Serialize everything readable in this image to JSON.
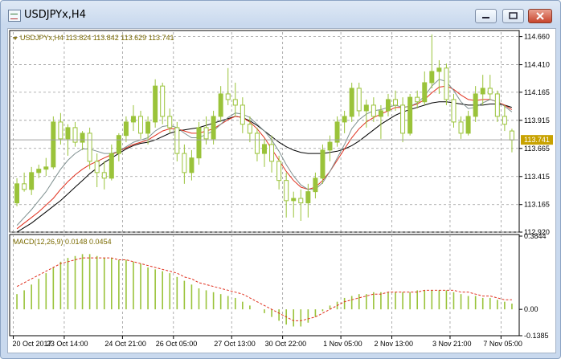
{
  "window": {
    "title": "USDJPYx,H4"
  },
  "chart_data": [
    {
      "type": "candlestick",
      "symbol": "USDJPYx",
      "timeframe": "H4",
      "info_line": "USDJPYx,H4  113.824 113.842 113.629 113.741",
      "ohlc_header": {
        "open": 113.824,
        "high": 113.842,
        "low": 113.629,
        "close": 113.741
      },
      "current_price": 113.741,
      "ylim": [
        112.92,
        114.7
      ],
      "y_ticks": [
        "114.660",
        "114.410",
        "114.165",
        "113.915",
        "113.665",
        "113.415",
        "113.165",
        "112.920"
      ],
      "x_ticks": [
        "20 Oct 2017",
        "23 Oct 14:00",
        "24 Oct 21:00",
        "26 Oct 05:00",
        "27 Oct 13:00",
        "30 Oct 22:00",
        "1 Nov 05:00",
        "2 Nov 13:00",
        "3 Nov 21:00",
        "7 Nov 05:00"
      ],
      "colors": {
        "bull": "#9ac33a",
        "bear": "#9ac33a",
        "ma_fast": "#7f9090",
        "ma_mid": "#e0301e",
        "ma_slow": "#000000",
        "price_line": "#a0a0a0",
        "price_tag": "#c8a200"
      },
      "candles": [
        [
          113.18,
          113.4,
          113.15,
          113.35
        ],
        [
          113.35,
          113.45,
          113.28,
          113.3
        ],
        [
          113.3,
          113.5,
          113.25,
          113.45
        ],
        [
          113.45,
          113.52,
          113.4,
          113.48
        ],
        [
          113.48,
          113.58,
          113.42,
          113.5
        ],
        [
          113.5,
          113.95,
          113.48,
          113.9
        ],
        [
          113.9,
          113.98,
          113.7,
          113.75
        ],
        [
          113.75,
          113.88,
          113.6,
          113.85
        ],
        [
          113.85,
          113.9,
          113.68,
          113.72
        ],
        [
          113.72,
          113.82,
          113.65,
          113.8
        ],
        [
          113.8,
          113.85,
          113.48,
          113.55
        ],
        [
          113.55,
          113.62,
          113.32,
          113.45
        ],
        [
          113.45,
          113.55,
          113.3,
          113.4
        ],
        [
          113.4,
          113.7,
          113.38,
          113.62
        ],
        [
          113.62,
          113.8,
          113.55,
          113.78
        ],
        [
          113.78,
          113.95,
          113.72,
          113.9
        ],
        [
          113.9,
          114.05,
          113.82,
          113.95
        ],
        [
          113.95,
          114.0,
          113.75,
          113.8
        ],
        [
          113.8,
          113.95,
          113.7,
          113.9
        ],
        [
          113.9,
          114.28,
          113.85,
          114.22
        ],
        [
          114.22,
          114.25,
          113.88,
          113.95
        ],
        [
          113.95,
          114.02,
          113.8,
          113.85
        ],
        [
          113.85,
          113.9,
          113.55,
          113.62
        ],
        [
          113.62,
          113.7,
          113.35,
          113.45
        ],
        [
          113.45,
          113.65,
          113.38,
          113.58
        ],
        [
          113.58,
          113.9,
          113.52,
          113.85
        ],
        [
          113.85,
          113.95,
          113.7,
          113.75
        ],
        [
          113.75,
          114.0,
          113.7,
          113.95
        ],
        [
          113.95,
          114.22,
          113.9,
          114.15
        ],
        [
          114.15,
          114.38,
          114.05,
          114.1
        ],
        [
          114.1,
          114.25,
          113.95,
          114.05
        ],
        [
          114.05,
          114.12,
          113.8,
          113.88
        ],
        [
          113.88,
          113.95,
          113.72,
          113.8
        ],
        [
          113.8,
          113.85,
          113.55,
          113.62
        ],
        [
          113.62,
          113.75,
          113.5,
          113.7
        ],
        [
          113.7,
          113.78,
          113.45,
          113.55
        ],
        [
          113.55,
          113.6,
          113.3,
          113.38
        ],
        [
          113.38,
          113.45,
          113.05,
          113.2
        ],
        [
          113.2,
          113.28,
          113.05,
          113.22
        ],
        [
          113.22,
          113.3,
          113.02,
          113.18
        ],
        [
          113.18,
          113.35,
          113.05,
          113.28
        ],
        [
          113.28,
          113.45,
          113.22,
          113.4
        ],
        [
          113.4,
          113.7,
          113.35,
          113.65
        ],
        [
          113.65,
          113.78,
          113.55,
          113.72
        ],
        [
          113.72,
          113.95,
          113.68,
          113.9
        ],
        [
          113.9,
          114.0,
          113.8,
          113.95
        ],
        [
          113.95,
          114.25,
          113.9,
          114.2
        ],
        [
          114.2,
          114.25,
          113.95,
          114.0
        ],
        [
          114.0,
          114.1,
          113.85,
          114.05
        ],
        [
          114.05,
          114.12,
          113.9,
          113.95
        ],
        [
          113.95,
          114.05,
          113.75,
          114.0
        ],
        [
          114.0,
          114.15,
          113.95,
          114.1
        ],
        [
          114.1,
          114.18,
          114.0,
          114.05
        ],
        [
          114.05,
          114.12,
          113.72,
          113.8
        ],
        [
          113.8,
          114.15,
          113.78,
          114.12
        ],
        [
          114.12,
          114.18,
          114.02,
          114.08
        ],
        [
          114.08,
          114.35,
          114.05,
          114.25
        ],
        [
          114.25,
          114.68,
          114.2,
          114.35
        ],
        [
          114.35,
          114.45,
          114.15,
          114.38
        ],
        [
          114.38,
          114.42,
          114.05,
          114.1
        ],
        [
          114.1,
          114.15,
          113.85,
          113.9
        ],
        [
          113.9,
          113.95,
          113.75,
          113.8
        ],
        [
          113.8,
          114.0,
          113.78,
          113.95
        ],
        [
          113.95,
          114.22,
          113.9,
          114.15
        ],
        [
          114.15,
          114.32,
          114.05,
          114.2
        ],
        [
          114.2,
          114.32,
          114.1,
          114.15
        ],
        [
          114.15,
          114.18,
          113.9,
          113.95
        ],
        [
          113.95,
          114.05,
          113.82,
          113.88
        ],
        [
          113.82,
          113.84,
          113.63,
          113.74
        ]
      ],
      "ma_fast": [
        112.98,
        113.05,
        113.12,
        113.2,
        113.28,
        113.38,
        113.48,
        113.56,
        113.62,
        113.66,
        113.66,
        113.64,
        113.62,
        113.62,
        113.64,
        113.68,
        113.72,
        113.74,
        113.76,
        113.82,
        113.86,
        113.87,
        113.85,
        113.8,
        113.76,
        113.76,
        113.79,
        113.82,
        113.88,
        113.94,
        113.98,
        113.97,
        113.94,
        113.88,
        113.82,
        113.74,
        113.64,
        113.52,
        113.42,
        113.34,
        113.3,
        113.3,
        113.36,
        113.46,
        113.58,
        113.7,
        113.84,
        113.92,
        113.97,
        114.0,
        114.01,
        114.03,
        114.05,
        114.03,
        114.04,
        114.07,
        114.13,
        114.22,
        114.28,
        114.26,
        114.18,
        114.08,
        114.02,
        114.03,
        114.07,
        114.1,
        114.08,
        114.04,
        113.99
      ],
      "ma_mid": [
        112.95,
        113.0,
        113.05,
        113.1,
        113.16,
        113.22,
        113.3,
        113.37,
        113.43,
        113.48,
        113.52,
        113.55,
        113.58,
        113.61,
        113.64,
        113.67,
        113.7,
        113.72,
        113.74,
        113.78,
        113.82,
        113.84,
        113.84,
        113.82,
        113.8,
        113.8,
        113.82,
        113.84,
        113.88,
        113.92,
        113.95,
        113.94,
        113.9,
        113.84,
        113.76,
        113.66,
        113.56,
        113.46,
        113.38,
        113.32,
        113.3,
        113.32,
        113.38,
        113.46,
        113.56,
        113.66,
        113.76,
        113.84,
        113.9,
        113.94,
        113.97,
        114.0,
        114.03,
        114.03,
        114.04,
        114.06,
        114.1,
        114.16,
        114.21,
        114.22,
        114.19,
        114.14,
        114.1,
        114.09,
        114.1,
        114.1,
        114.08,
        114.05,
        114.01
      ],
      "ma_slow": [
        112.92,
        112.96,
        113.0,
        113.05,
        113.1,
        113.15,
        113.2,
        113.26,
        113.32,
        113.38,
        113.44,
        113.49,
        113.54,
        113.58,
        113.62,
        113.66,
        113.69,
        113.71,
        113.72,
        113.74,
        113.77,
        113.8,
        113.82,
        113.83,
        113.84,
        113.85,
        113.87,
        113.89,
        113.91,
        113.93,
        113.95,
        113.94,
        113.91,
        113.87,
        113.82,
        113.77,
        113.72,
        113.68,
        113.65,
        113.63,
        113.62,
        113.62,
        113.62,
        113.63,
        113.64,
        113.66,
        113.69,
        113.73,
        113.78,
        113.83,
        113.88,
        113.92,
        113.96,
        113.99,
        114.01,
        114.03,
        114.05,
        114.07,
        114.08,
        114.08,
        114.07,
        114.06,
        114.05,
        114.05,
        114.05,
        114.06,
        114.06,
        114.05,
        114.03
      ]
    },
    {
      "type": "bar",
      "indicator": "MACD",
      "info_line": "MACD(12,26,9) 0.0148 0.0454",
      "macd": 0.0148,
      "signal": 0.0454,
      "ylim": [
        -0.1385,
        0.3844
      ],
      "y_ticks": [
        "0.3844",
        "0.00",
        "-0.1385"
      ],
      "histogram": [
        0.08,
        0.1,
        0.13,
        0.16,
        0.19,
        0.22,
        0.25,
        0.27,
        0.28,
        0.29,
        0.29,
        0.28,
        0.27,
        0.27,
        0.26,
        0.26,
        0.25,
        0.24,
        0.22,
        0.21,
        0.2,
        0.19,
        0.17,
        0.15,
        0.13,
        0.11,
        0.1,
        0.09,
        0.08,
        0.07,
        0.06,
        0.04,
        0.02,
        0.0,
        -0.02,
        -0.04,
        -0.06,
        -0.08,
        -0.09,
        -0.09,
        -0.07,
        -0.04,
        -0.01,
        0.02,
        0.04,
        0.06,
        0.07,
        0.08,
        0.08,
        0.09,
        0.09,
        0.09,
        0.09,
        0.09,
        0.09,
        0.1,
        0.1,
        0.1,
        0.1,
        0.1,
        0.09,
        0.08,
        0.07,
        0.07,
        0.06,
        0.06,
        0.05,
        0.04,
        0.03
      ],
      "signal_line": [
        0.12,
        0.14,
        0.16,
        0.18,
        0.2,
        0.22,
        0.24,
        0.25,
        0.26,
        0.27,
        0.27,
        0.27,
        0.27,
        0.27,
        0.26,
        0.26,
        0.25,
        0.24,
        0.23,
        0.22,
        0.21,
        0.2,
        0.19,
        0.17,
        0.16,
        0.14,
        0.13,
        0.12,
        0.11,
        0.1,
        0.09,
        0.08,
        0.06,
        0.04,
        0.02,
        0.0,
        -0.02,
        -0.04,
        -0.06,
        -0.06,
        -0.05,
        -0.04,
        -0.02,
        0.0,
        0.02,
        0.04,
        0.05,
        0.06,
        0.07,
        0.08,
        0.08,
        0.09,
        0.09,
        0.09,
        0.09,
        0.09,
        0.1,
        0.1,
        0.1,
        0.1,
        0.1,
        0.09,
        0.09,
        0.08,
        0.07,
        0.07,
        0.06,
        0.05,
        0.05
      ],
      "colors": {
        "bars": "#9ac33a",
        "signal": "#e0301e"
      }
    }
  ]
}
